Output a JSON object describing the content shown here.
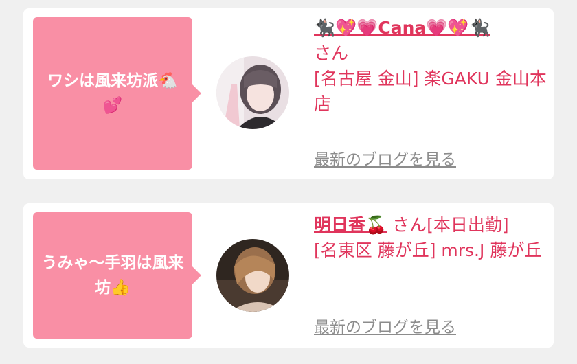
{
  "cards": [
    {
      "bubble_text": "ワシは風来坊派🐔💕",
      "name": "🐈‍⬛💖💗Cana💗💖🐈‍⬛",
      "honorific": "さん",
      "store": "[名古屋 金山] 楽GAKU 金山本店",
      "blog_link": "最新のブログを見る"
    },
    {
      "bubble_text": "うみゃ〜手羽は風来坊👍",
      "name": "明日香🍒",
      "honorific": "さん[本日出勤]",
      "store": "[名東区 藤が丘] mrs.J 藤が丘",
      "blog_link": "最新のブログを見る"
    }
  ],
  "colors": {
    "background": "#f0f0f0",
    "card": "#ffffff",
    "bubble": "#f98fa5",
    "accent_text": "#e0355c",
    "link_gray": "#8c8c8c"
  }
}
